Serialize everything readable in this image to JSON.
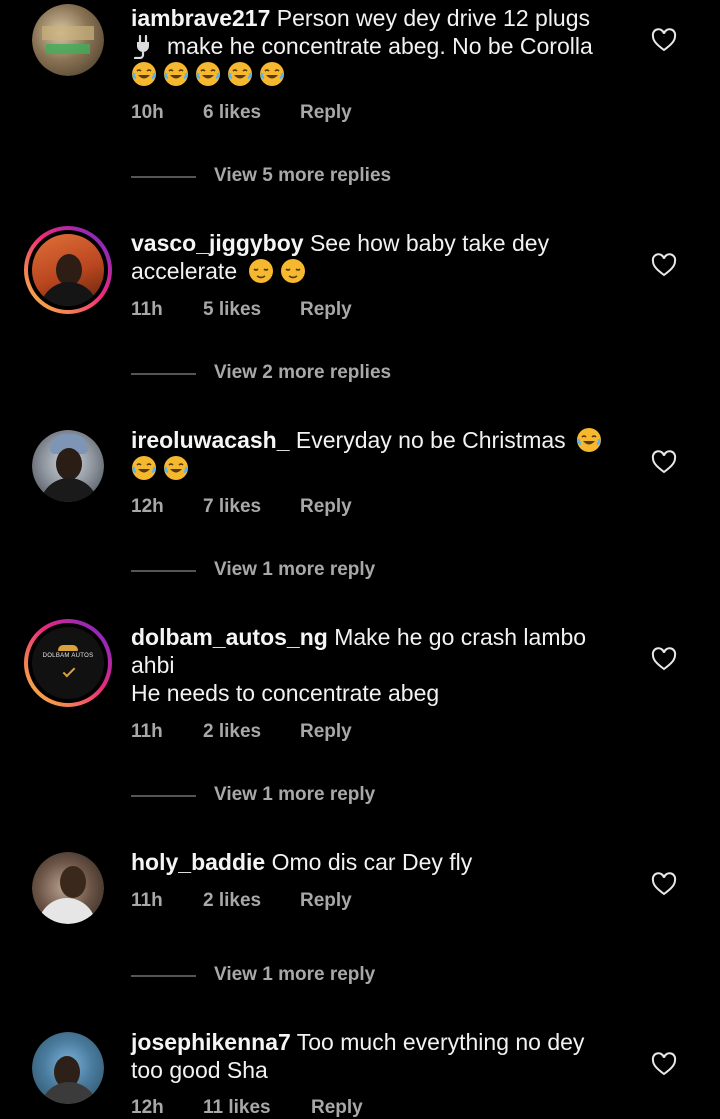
{
  "comments": [
    {
      "username": "iambrave217",
      "lines": [
        "Person wey dey drive 12 plugs",
        "make he concentrate abeg. No be Corolla"
      ],
      "line2_prefix_icon": "plug-icon",
      "emojis": [
        "😂",
        "😂",
        "😂",
        "😂",
        "😂"
      ],
      "time": "10h",
      "likes": "6 likes",
      "reply": "Reply",
      "view_replies": "View 5 more replies",
      "avatar": "building-lights-avatar",
      "story_ring": false
    },
    {
      "username": "vasco_jiggyboy",
      "lines": [
        "See how baby take dey",
        "accelerate"
      ],
      "emojis": [
        "😌",
        "😌"
      ],
      "time": "11h",
      "likes": "5 likes",
      "reply": "Reply",
      "view_replies": "View 2 more replies",
      "avatar": "man-orange-background-avatar",
      "story_ring": true
    },
    {
      "username": "ireoluwacash_",
      "lines": [
        "Everyday no be Christmas"
      ],
      "emojis": [
        "😂",
        "😂",
        "😂"
      ],
      "time": "12h",
      "likes": "7 likes",
      "reply": "Reply",
      "view_replies": "View 1 more reply",
      "avatar": "man-beanie-avatar",
      "story_ring": false
    },
    {
      "username": "dolbam_autos_ng",
      "lines": [
        "Make he go crash lambo",
        "ahbi",
        "He needs to concentrate abeg"
      ],
      "emojis": [],
      "time": "11h",
      "likes": "2 likes",
      "reply": "Reply",
      "view_replies": "View 1 more reply",
      "avatar": "dolbam-autos-logo-avatar",
      "brand_text": "DOLBAM AUTOS",
      "story_ring": true
    },
    {
      "username": "holy_baddie",
      "lines": [
        "Omo dis car Dey fly"
      ],
      "emojis": [],
      "time": "11h",
      "likes": "2 likes",
      "reply": "Reply",
      "view_replies": "View 1 more reply",
      "avatar": "man-selfie-avatar",
      "story_ring": false
    },
    {
      "username": "josephikenna7",
      "lines": [
        "Too much everything no dey",
        "too good Sha"
      ],
      "emojis": [],
      "time": "12h",
      "likes": "11 likes",
      "reply": "Reply",
      "avatar": "man-outdoor-avatar",
      "story_ring": false
    }
  ],
  "colors": {
    "background": "#000000",
    "primary_text": "#f5f5f5",
    "secondary_text": "#a8a8a8",
    "divider": "#555555"
  }
}
